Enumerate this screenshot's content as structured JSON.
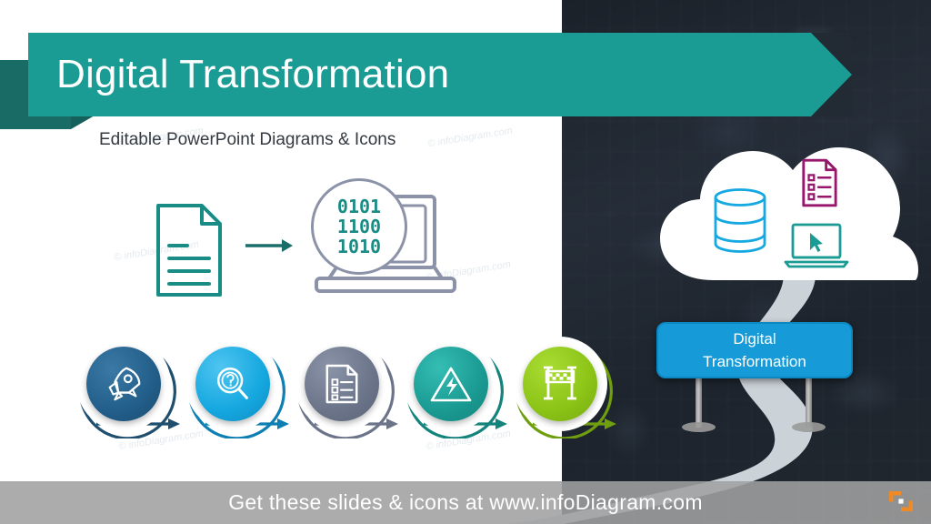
{
  "slide": {
    "title": "Digital Transformation",
    "subtitle": "Editable PowerPoint Diagrams & Icons",
    "footer_text": "Get these slides & icons at www.infoDiagram.com",
    "watermark": "© infoDiagram.com",
    "logo_name": "infodiagram-logo"
  },
  "colors": {
    "teal_ribbon": "#1A9B93",
    "teal_fold": "#196B66",
    "dark_bg": "#222a33",
    "sign_blue": "#169BD8",
    "road_gray": "#CBD2D8",
    "footer_gray": "#A0A0A0",
    "logo_orange": "#F08A24"
  },
  "transformation_flow": {
    "source_doc_label": "document-icon",
    "arrow_label": "arrow-right",
    "binary_lines": [
      "0101",
      "1100",
      "1010"
    ],
    "binary_color": "#1A8C86",
    "target_label": "laptop-icon"
  },
  "steps": [
    {
      "id": "launch",
      "icon": "rocket-icon",
      "color": "#2B6590",
      "ring_color": "#1F4E6E",
      "arrow_color": "#1F4E6E"
    },
    {
      "id": "discover",
      "icon": "magnifier-question-icon",
      "color": "#16A8E0",
      "ring_color": "#0E7FB2",
      "arrow_color": "#0E7FB2"
    },
    {
      "id": "plan",
      "icon": "checklist-document-icon",
      "color": "#6B7489",
      "ring_color": "#6B7489",
      "arrow_color": "#6B7489"
    },
    {
      "id": "risk",
      "icon": "warning-lightning-icon",
      "color": "#1A9B93",
      "ring_color": "#14837C",
      "arrow_color": "#14837C"
    },
    {
      "id": "finish",
      "icon": "finish-line-icon",
      "color": "#8CC417",
      "ring_color": "#6F9E0E",
      "arrow_color": "#6F9E0E"
    }
  ],
  "cloud": {
    "name": "cloud-shape",
    "items": [
      {
        "icon": "database-icon",
        "color": "#16A8E0"
      },
      {
        "icon": "checklist-document-icon",
        "color": "#97176C"
      },
      {
        "icon": "laptop-cursor-icon",
        "color": "#1A9B93"
      }
    ]
  },
  "road_sign": {
    "line1": "Digital",
    "line2": "Transformation"
  }
}
